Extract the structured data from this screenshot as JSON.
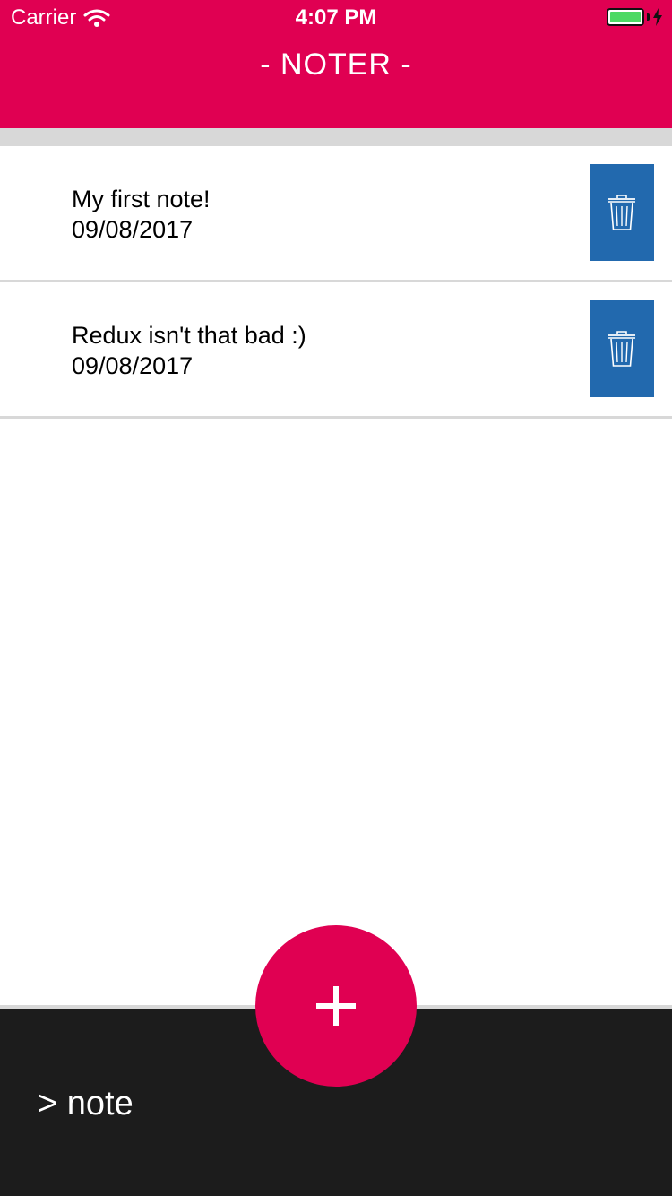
{
  "status_bar": {
    "carrier": "Carrier",
    "time": "4:07 PM",
    "wifi_icon": "wifi-icon",
    "battery_icon": "battery-icon",
    "charging_icon": "bolt-icon"
  },
  "header": {
    "title": "- NOTER -"
  },
  "notes": [
    {
      "title": "My first note!",
      "date": "09/08/2017",
      "delete_icon": "trash-icon"
    },
    {
      "title": "Redux isn't that bad :)",
      "date": "09/08/2017",
      "delete_icon": "trash-icon"
    }
  ],
  "input": {
    "value": "> note"
  },
  "add_button": {
    "icon": "plus-icon"
  },
  "colors": {
    "accent": "#E00052",
    "delete": "#2269AE",
    "bottom_bar": "#1C1C1C",
    "divider": "#D8D8D8",
    "battery": "#4CD964"
  }
}
